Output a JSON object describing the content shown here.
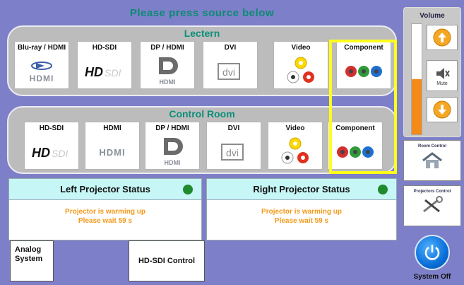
{
  "banner": "Please press source below",
  "lectern": {
    "title": "Lectern",
    "sources": [
      {
        "label": "Blu-ray / HDMI",
        "icon": "bluray-hdmi-icon"
      },
      {
        "label": "HD-SDI",
        "icon": "hd-sdi-icon"
      },
      {
        "label": "DP / HDMI",
        "icon": "displayport-icon"
      },
      {
        "label": "DVI",
        "icon": "dvi-icon"
      },
      {
        "label": "Video",
        "icon": "composite-video-icon"
      },
      {
        "label": "Component",
        "icon": "component-video-icon"
      }
    ]
  },
  "control_room": {
    "title": "Control Room",
    "sources": [
      {
        "label": "HD-SDI",
        "icon": "hd-sdi-icon"
      },
      {
        "label": "HDMI",
        "icon": "hdmi-icon"
      },
      {
        "label": "DP / HDMI",
        "icon": "displayport-icon"
      },
      {
        "label": "DVI",
        "icon": "dvi-icon"
      },
      {
        "label": "Video",
        "icon": "composite-video-icon"
      },
      {
        "label": "Component",
        "icon": "component-video-icon"
      }
    ]
  },
  "left_projector": {
    "title": "Left Projector Status",
    "line1": "Projector is warming up",
    "line2": "Please wait  59  s"
  },
  "right_projector": {
    "title": "Right Projector Status",
    "line1": "Projector is warming up",
    "line2": "Please wait  59  s"
  },
  "buttons": {
    "analog": "Analog System",
    "hdsdi_control": "HD-SDI Control"
  },
  "volume": {
    "title": "Volume",
    "level": 0.5,
    "mute_label": "Mute"
  },
  "side": {
    "room_control": "Room Control",
    "projectors_control": "Projectors Control",
    "system_off": "System Off"
  },
  "colors": {
    "background": "#7d80c8",
    "accent_green": "#0d8f78",
    "status_bg": "#c6f6f6",
    "highlight": "#ffff1a",
    "warning_text": "#f39a1a",
    "volume_fill": "#f28b1a"
  }
}
